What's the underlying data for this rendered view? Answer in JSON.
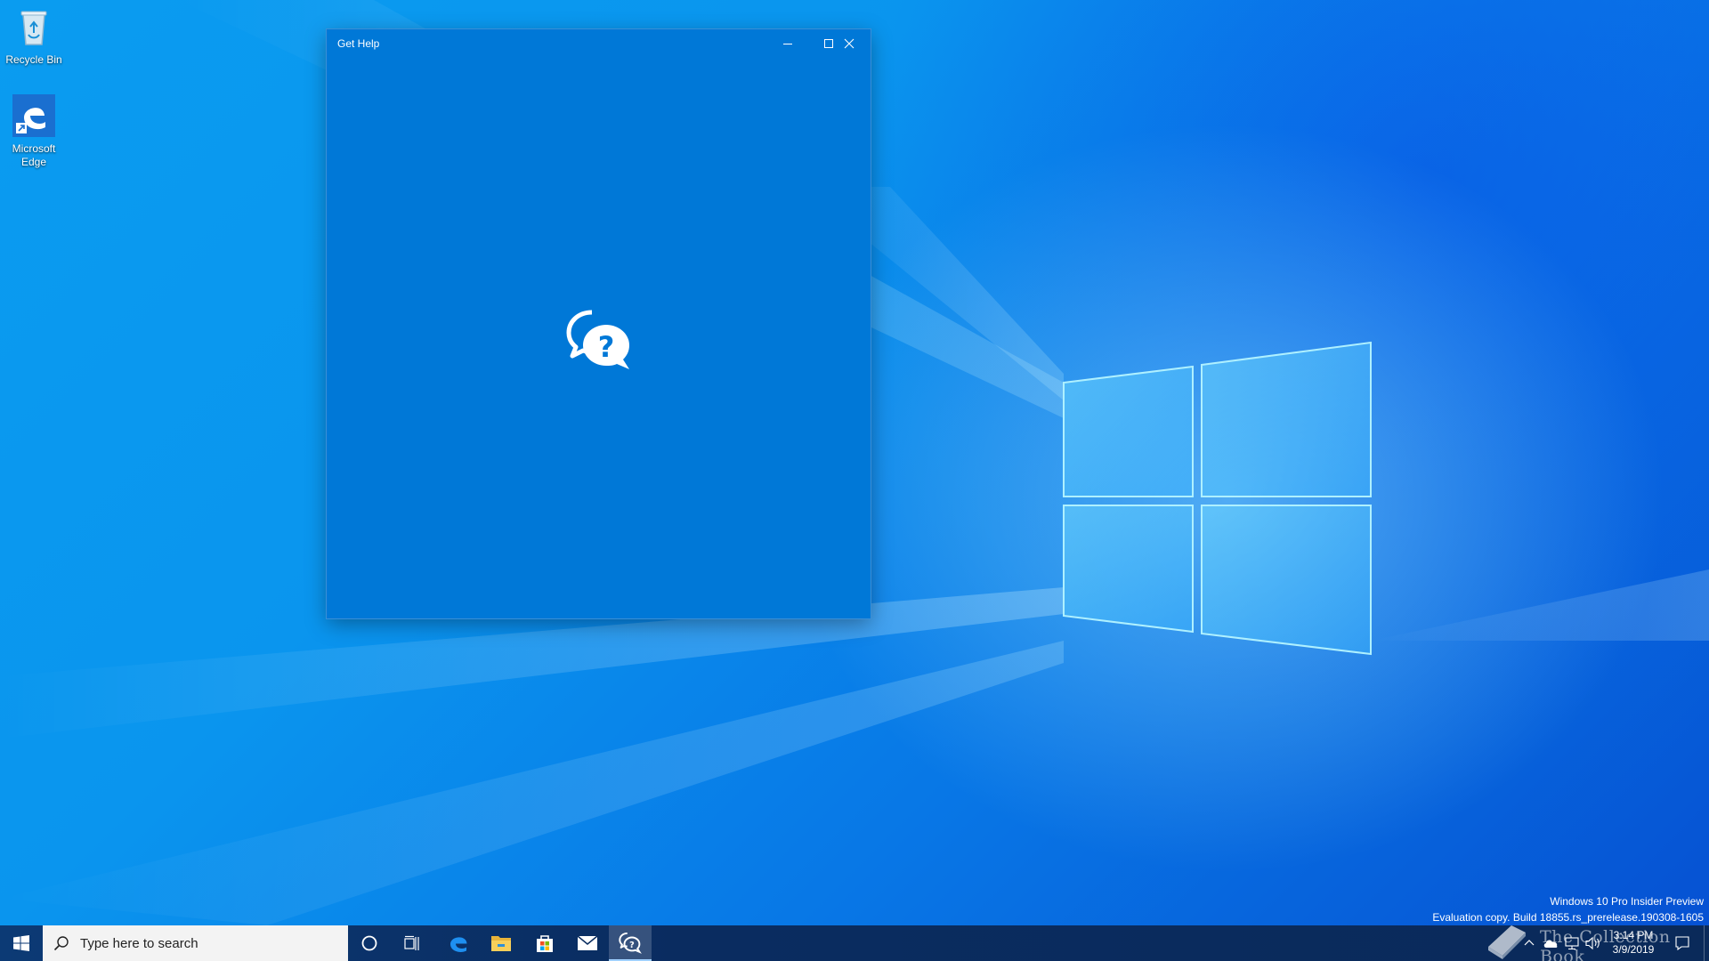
{
  "desktop": {
    "icons": [
      {
        "label": "Recycle Bin",
        "icon": "recycle-bin-icon"
      },
      {
        "label": "Microsoft Edge",
        "icon": "edge-icon"
      }
    ],
    "watermark": {
      "line1": "Windows 10 Pro Insider Preview",
      "line2": "Evaluation copy. Build 18855.rs_prerelease.190308-1605"
    },
    "overlay_brand": "The Collection Book"
  },
  "window": {
    "title": "Get Help",
    "background_color": "#0078d7",
    "splash_icon": "get-help-chat-question-icon",
    "controls": {
      "minimize": "minimize-icon",
      "maximize": "maximize-icon",
      "close": "close-icon"
    }
  },
  "taskbar": {
    "search": {
      "placeholder": "Type here to search"
    },
    "pinned": [
      {
        "name": "cortana",
        "icon": "cortana-icon"
      },
      {
        "name": "task-view",
        "icon": "task-view-icon"
      },
      {
        "name": "edge",
        "icon": "edge-icon"
      },
      {
        "name": "file-explorer",
        "icon": "folder-icon"
      },
      {
        "name": "store",
        "icon": "store-icon"
      },
      {
        "name": "mail",
        "icon": "mail-icon"
      },
      {
        "name": "get-help",
        "icon": "get-help-icon",
        "active": true
      }
    ],
    "tray": {
      "icons": [
        "chevron-up-icon",
        "onedrive-icon",
        "network-icon",
        "volume-icon"
      ],
      "time": "3:14 PM",
      "date": "3/9/2019"
    }
  }
}
